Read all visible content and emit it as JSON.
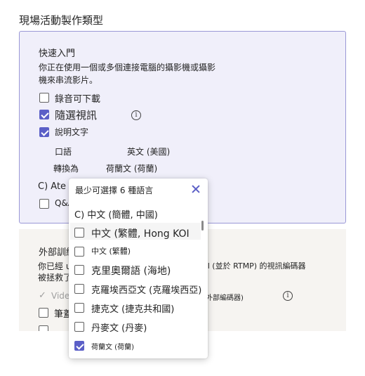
{
  "section": {
    "title": "現場活動製作類型"
  },
  "quick_start": {
    "title": "快速入門",
    "description_line1": "你正在使用一個或多個連接電腦的攝影機或攝影",
    "description_line2": "機來串流影片。",
    "options": [
      {
        "label": "錄音可下載",
        "checked": false
      },
      {
        "label": "隨選視訊",
        "checked": true
      },
      {
        "label": "說明文字",
        "checked": true
      }
    ],
    "spoken_label": "口語",
    "spoken_value": "英文 (美國)",
    "translate_label": "轉換為",
    "translate_value": "荷蘭文 (荷蘭)",
    "attendee_label": "C) Ate",
    "qa_label": "Q&A"
  },
  "external": {
    "title": "外部訓練",
    "desc_line1_left": "你已經 u",
    "desc_line1_right": "ol (並於 RTMP) 的視訊編碼器",
    "desc_line2": "被拯救了",
    "video_label": "Vide",
    "encoder_label": "外部編碼器)",
    "checkbox_label": "筆蓋"
  },
  "dropdown": {
    "header": "最少可選擇 6 種語言",
    "items": [
      {
        "label": "C) 中文 (簡體, 中國)",
        "checked": null
      },
      {
        "label": "中文 (繁體, Hong KOI",
        "checked": false
      },
      {
        "label": "中文 (繁體)",
        "checked": false
      },
      {
        "label": "克里奧爾語 (海地)",
        "checked": false
      },
      {
        "label": "克羅埃西亞文 (克羅埃西亞)",
        "checked": false
      },
      {
        "label": "捷克文 (捷克共和國)",
        "checked": false
      },
      {
        "label": "丹麥文 (丹麥)",
        "checked": false
      },
      {
        "label": "荷蘭文 (荷蘭)",
        "checked": true
      }
    ]
  },
  "colors": {
    "accent": "#5b5fc7",
    "selected_bg": "#f0effa",
    "selected_border": "#9a98d6"
  },
  "icons": {
    "info": "info-icon",
    "close": "close-icon",
    "check": "check-icon"
  }
}
